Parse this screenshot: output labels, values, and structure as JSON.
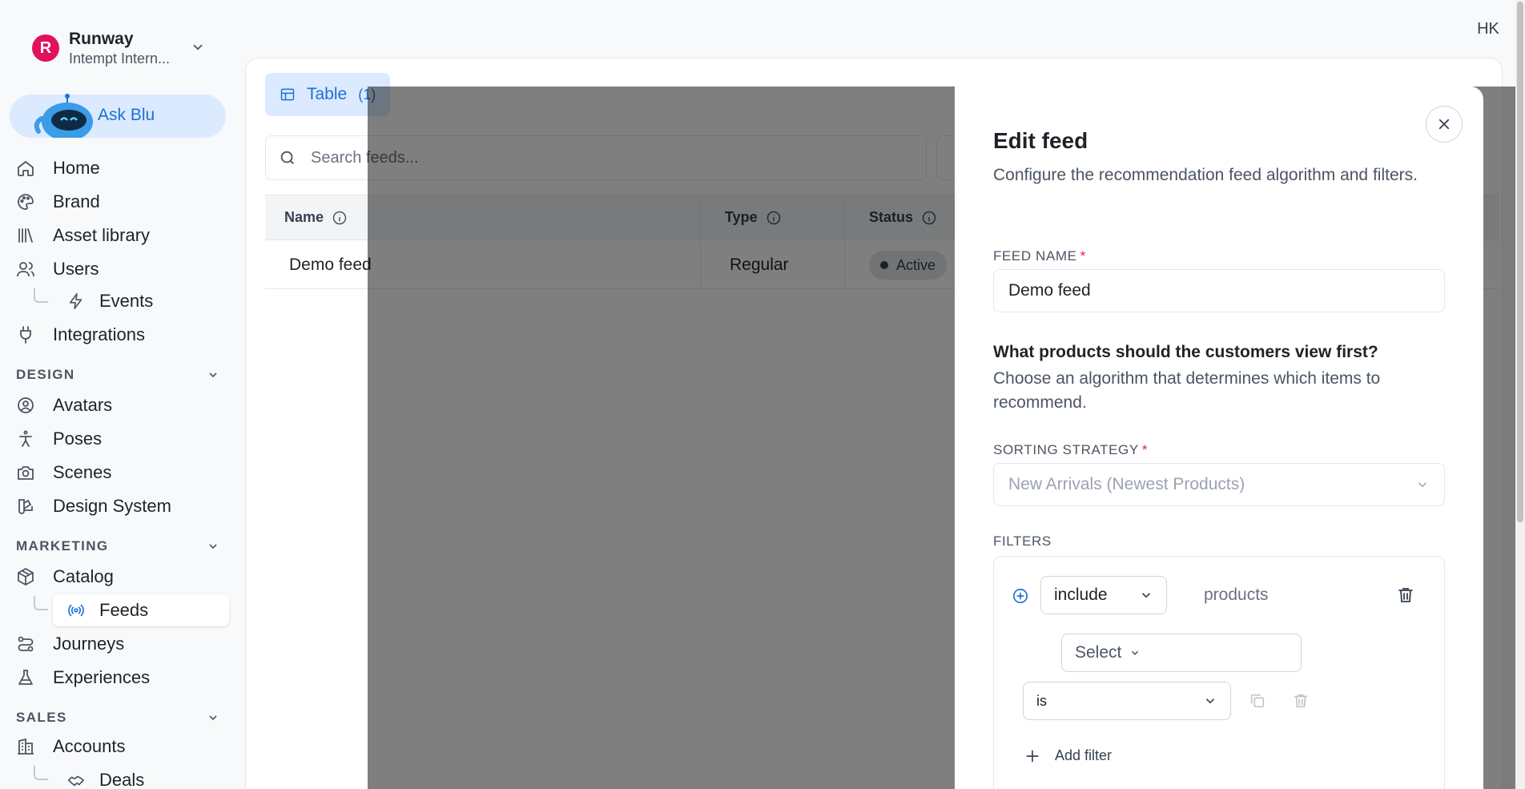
{
  "workspace": {
    "name": "Runway",
    "subtitle": "Intempt Intern...",
    "logo_letter": "R"
  },
  "ask_blu": {
    "label": "Ask Blu"
  },
  "nav": {
    "home": "Home",
    "brand": "Brand",
    "asset_library": "Asset library",
    "users": "Users",
    "events": "Events",
    "integrations": "Integrations",
    "design_section": "DESIGN",
    "avatars": "Avatars",
    "poses": "Poses",
    "scenes": "Scenes",
    "design_system": "Design System",
    "marketing_section": "MARKETING",
    "catalog": "Catalog",
    "feeds": "Feeds",
    "journeys": "Journeys",
    "experiences": "Experiences",
    "sales_section": "SALES",
    "accounts": "Accounts",
    "deals": "Deals"
  },
  "user_initials": "HK",
  "main": {
    "tab_label": "Table",
    "tab_count": "(1)",
    "search_placeholder": "Search feeds...",
    "columns": {
      "name": "Name",
      "type": "Type",
      "status": "Status"
    },
    "rows": [
      {
        "name": "Demo feed",
        "type": "Regular",
        "status": "Active"
      }
    ]
  },
  "drawer": {
    "title": "Edit feed",
    "description": "Configure the recommendation feed algorithm and filters.",
    "feed_name_label": "FEED NAME",
    "required_mark": "*",
    "feed_name_value": "Demo feed",
    "question_title": "What products should the customers view first?",
    "question_desc": "Choose an algorithm that determines which items to recommend.",
    "sorting_label": "SORTING STRATEGY",
    "sorting_value": "New Arrivals (Newest Products)",
    "filters_label": "FILTERS",
    "filter": {
      "mode": "include",
      "target": "products",
      "attribute_placeholder": "Select",
      "operator": "is"
    },
    "add_filter_label": "Add filter"
  },
  "colors": {
    "accent": "#1d70d6",
    "accent_bg": "#dbeafe",
    "brand": "#e0115f",
    "required": "#e11d48"
  }
}
